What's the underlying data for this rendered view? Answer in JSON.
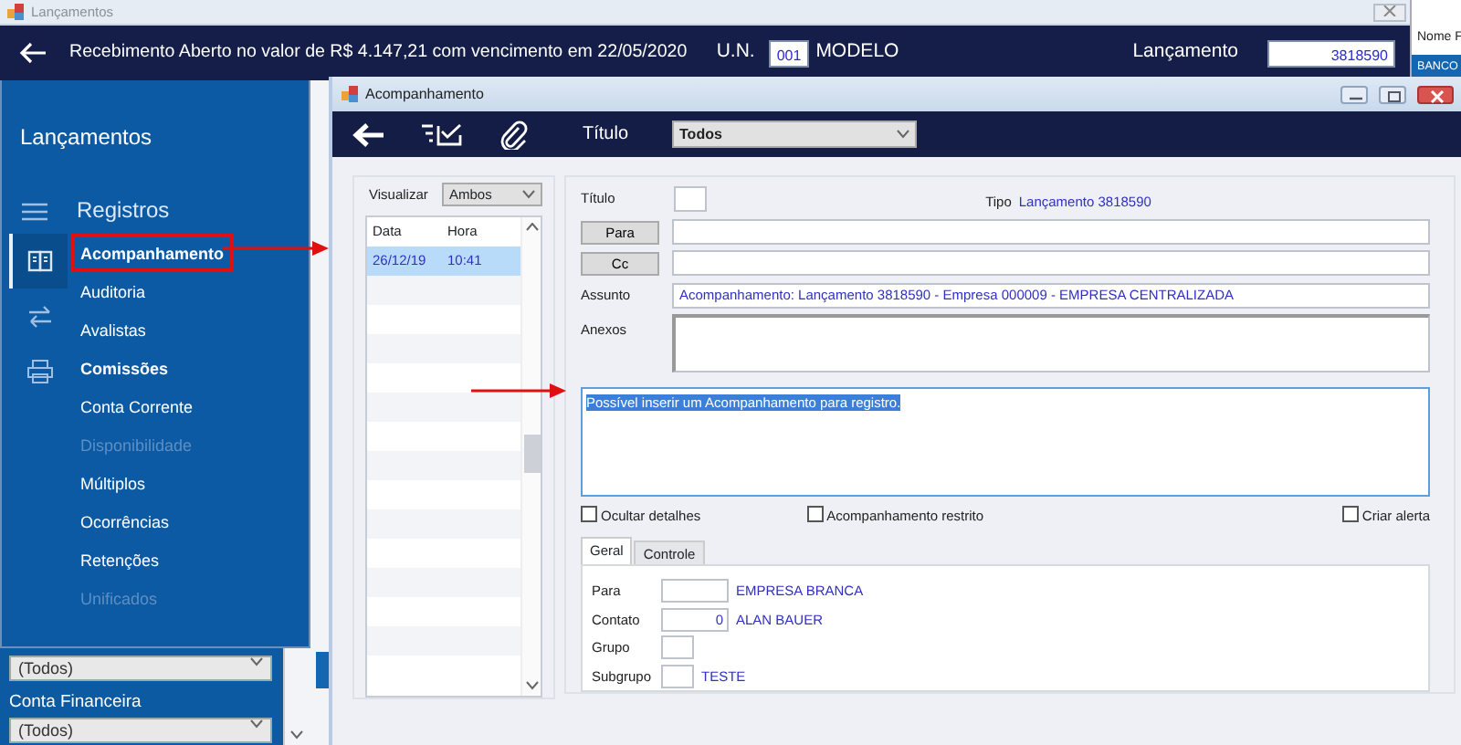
{
  "window": {
    "title": "Lançamentos"
  },
  "header": {
    "title": "Recebimento Aberto no valor de R$ 4.147,21 com vencimento em 22/05/2020",
    "un_label": "U.N.",
    "un_value": "001",
    "un_name": "MODELO",
    "entry_label": "Lançamento",
    "entry_value": "3818590"
  },
  "background_window": {
    "column_header": "Nome F",
    "row": "BANCO"
  },
  "sidebar": {
    "title": "Lançamentos",
    "section": "Registros",
    "rail": [
      {
        "selected": true
      },
      {
        "selected": false
      },
      {
        "selected": false
      }
    ],
    "items": [
      {
        "label": "Acompanhamento",
        "selected": true,
        "bold": true,
        "disabled": false
      },
      {
        "label": "Auditoria",
        "selected": false,
        "bold": false,
        "disabled": false
      },
      {
        "label": "Avalistas",
        "selected": false,
        "bold": false,
        "disabled": false
      },
      {
        "label": "Comissões",
        "selected": false,
        "bold": true,
        "disabled": false
      },
      {
        "label": "Conta Corrente",
        "selected": false,
        "bold": false,
        "disabled": false
      },
      {
        "label": "Disponibilidade",
        "selected": false,
        "bold": false,
        "disabled": true
      },
      {
        "label": "Múltiplos",
        "selected": false,
        "bold": false,
        "disabled": false
      },
      {
        "label": "Ocorrências",
        "selected": false,
        "bold": false,
        "disabled": false
      },
      {
        "label": "Retenções",
        "selected": false,
        "bold": false,
        "disabled": false
      },
      {
        "label": "Unificados",
        "selected": false,
        "bold": false,
        "disabled": true
      }
    ]
  },
  "filters": [
    {
      "kind": "select",
      "value": "(Todos)"
    },
    {
      "kind": "label",
      "text": "Conta Financeira"
    },
    {
      "kind": "select",
      "value": "(Todos)"
    }
  ],
  "dialog": {
    "title": "Acompanhamento",
    "toolbar": {
      "title_label": "Título",
      "title_filter": "Todos"
    },
    "history": {
      "view_label": "Visualizar",
      "view_value": "Ambos",
      "columns": [
        "Data",
        "Hora"
      ],
      "rows": [
        {
          "cells": [
            "26/12/19",
            "10:41"
          ],
          "selected": true
        }
      ]
    },
    "form": {
      "title_label": "Título",
      "type_label": "Tipo",
      "type_value": "Lançamento 3818590",
      "to_button": "Para",
      "cc_button": "Cc",
      "subject_label": "Assunto",
      "subject_value": "Acompanhamento: Lançamento 3818590 - Empresa 000009 - EMPRESA CENTRALIZADA",
      "attachments_label": "Anexos",
      "message": "Possível inserir um Acompanhamento para registro.",
      "checkboxes": [
        {
          "label": "Ocultar detalhes",
          "checked": false
        },
        {
          "label": "Acompanhamento restrito",
          "checked": false
        },
        {
          "label": "Criar alerta",
          "checked": false
        }
      ],
      "tabs": [
        {
          "label": "Geral",
          "selected": true
        },
        {
          "label": "Controle",
          "selected": false
        }
      ],
      "fields": [
        {
          "label": "Para",
          "wide": true,
          "description": "EMPRESA BRANCA"
        },
        {
          "label": "Contato",
          "value": "0",
          "wide": true,
          "description": "ALAN BAUER"
        },
        {
          "label": "Grupo",
          "wide": false
        },
        {
          "label": "Subgrupo",
          "wide": false,
          "description": "TESTE"
        }
      ]
    }
  }
}
